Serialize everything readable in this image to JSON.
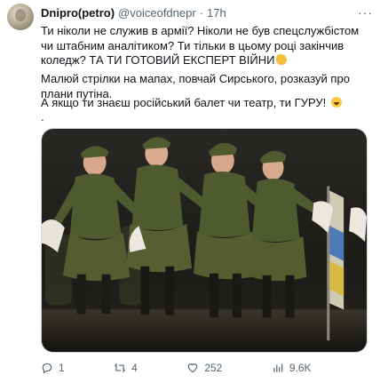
{
  "post": {
    "author_name": "Dnipro(petro)",
    "handle": "@voiceofdnepr",
    "separator": "·",
    "time": "17h",
    "more_label": "···",
    "paragraphs": [
      "Ти ніколи не служив в армії? Ніколи не був спецслужбістом чи штабним аналітиком? Ти тільки в цьому році закінчив коледж? ТА ТИ ГОТОВИЙ ЕКСПЕРТ ВІЙНИ",
      "Малюй стрілки на мапах, повчай Сирського, розказуй про плани путіна.",
      "А якщо ти знаєш російський балет чи театр, ти ГУРУ!",
      "."
    ],
    "emojis": [
      "flexed-biceps",
      "grinning-squinting-face"
    ]
  },
  "actions": {
    "reply_count": "1",
    "repost_count": "4",
    "like_count": "252",
    "view_count": "9.6K"
  },
  "colors": {
    "text": "#0f1419",
    "secondary": "#536471",
    "uniform": "#4f5a2e",
    "background_dark": "#1b1a16"
  }
}
